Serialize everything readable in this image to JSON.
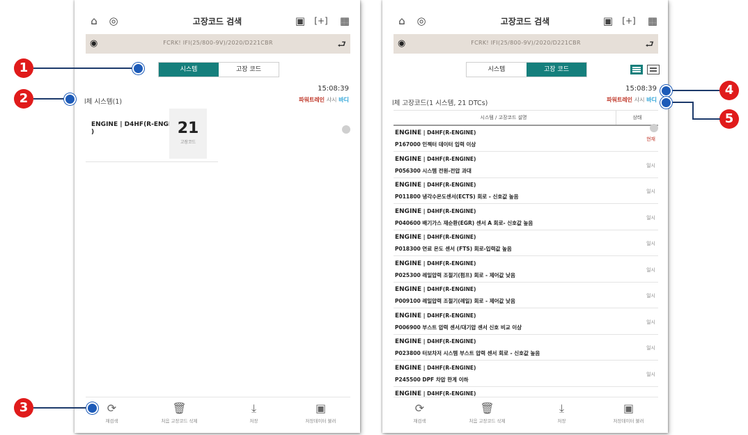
{
  "left": {
    "title": "고장코드 검색",
    "vehicle": "FCRK! IFI(25/800-9V)/2020/D221CBR",
    "tabs": [
      "시스템",
      "고장 코드"
    ],
    "active_tab": 0,
    "time": "15:08:39",
    "total": "l체 시스템(1)",
    "filters": [
      "파워트레인",
      "샤시",
      "바디"
    ],
    "system": {
      "name": "ENGINE | D4HF(R-ENGINE\n)",
      "count": "21",
      "count_label": "고장코드"
    }
  },
  "right": {
    "title": "고장코드 검색",
    "vehicle": "FCRK! IFI(25/800-9V)/2020/D221CBR",
    "tabs": [
      "시스템",
      "고장 코드"
    ],
    "active_tab": 1,
    "time": "15:08:39",
    "total": "l체 고장코드(1 시스템, 21 DTCs)",
    "filters": [
      "파워트레인",
      "샤시",
      "바디"
    ],
    "columns": [
      "시스템 / 고장코드 설명",
      "상태"
    ],
    "dtc_rows": [
      {
        "sys": "ENGINE",
        "sub": "D4HF(R-ENGINE)",
        "desc": "P167000 인젝터 데이터 입력 이상",
        "status": "현재"
      },
      {
        "sys": "ENGINE",
        "sub": "D4HF(R-ENGINE)",
        "desc": "P056300 시스템 전원-전압 과대",
        "status": "일시"
      },
      {
        "sys": "ENGINE",
        "sub": "D4HF(R-ENGINE)",
        "desc": "P011800 냉각수온도센서(ECTS) 회로 - 신호값 높음",
        "status": "일시"
      },
      {
        "sys": "ENGINE",
        "sub": "D4HF(R-ENGINE)",
        "desc": "P040600 배기가스 재순환(EGR) 센서 A 회로- 신호값 높음",
        "status": "일시"
      },
      {
        "sys": "ENGINE",
        "sub": "D4HF(R-ENGINE)",
        "desc": "P018300 연료 온도 센서 (FTS) 회로-입력값 높음",
        "status": "일시"
      },
      {
        "sys": "ENGINE",
        "sub": "D4HF(R-ENGINE)",
        "desc": "P025300 레일압력 조절기(펌프) 회로 - 제어값 낮음",
        "status": "일시"
      },
      {
        "sys": "ENGINE",
        "sub": "D4HF(R-ENGINE)",
        "desc": "P009100 레일압력 조절기(레일) 회로 - 제어값 낮음",
        "status": "일시"
      },
      {
        "sys": "ENGINE",
        "sub": "D4HF(R-ENGINE)",
        "desc": "P006900 부스트 압력 센서/대기압 센서 신호 비교 이상",
        "status": "일시"
      },
      {
        "sys": "ENGINE",
        "sub": "D4HF(R-ENGINE)",
        "desc": "P023800 터보차저 시스템 부스트 압력 센서 회로 - 신호값 높음",
        "status": "일시"
      },
      {
        "sys": "ENGINE",
        "sub": "D4HF(R-ENGINE)",
        "desc": "P245500 DPF 차압 한계 이하",
        "status": "일시"
      },
      {
        "sys": "ENGINE",
        "sub": "D4HF(R-ENGINE)",
        "desc": "",
        "status": ""
      }
    ]
  },
  "bottom_buttons": [
    "재검색",
    "처음 고장코드 삭제",
    "저장",
    "저장데이터 불러"
  ],
  "callouts": [
    "1",
    "2",
    "3",
    "4",
    "5"
  ],
  "colors": {
    "accent": "#157f7c",
    "callout": "#e01b1b",
    "powertrain": "#c0392b",
    "body": "#2aa3d8"
  }
}
